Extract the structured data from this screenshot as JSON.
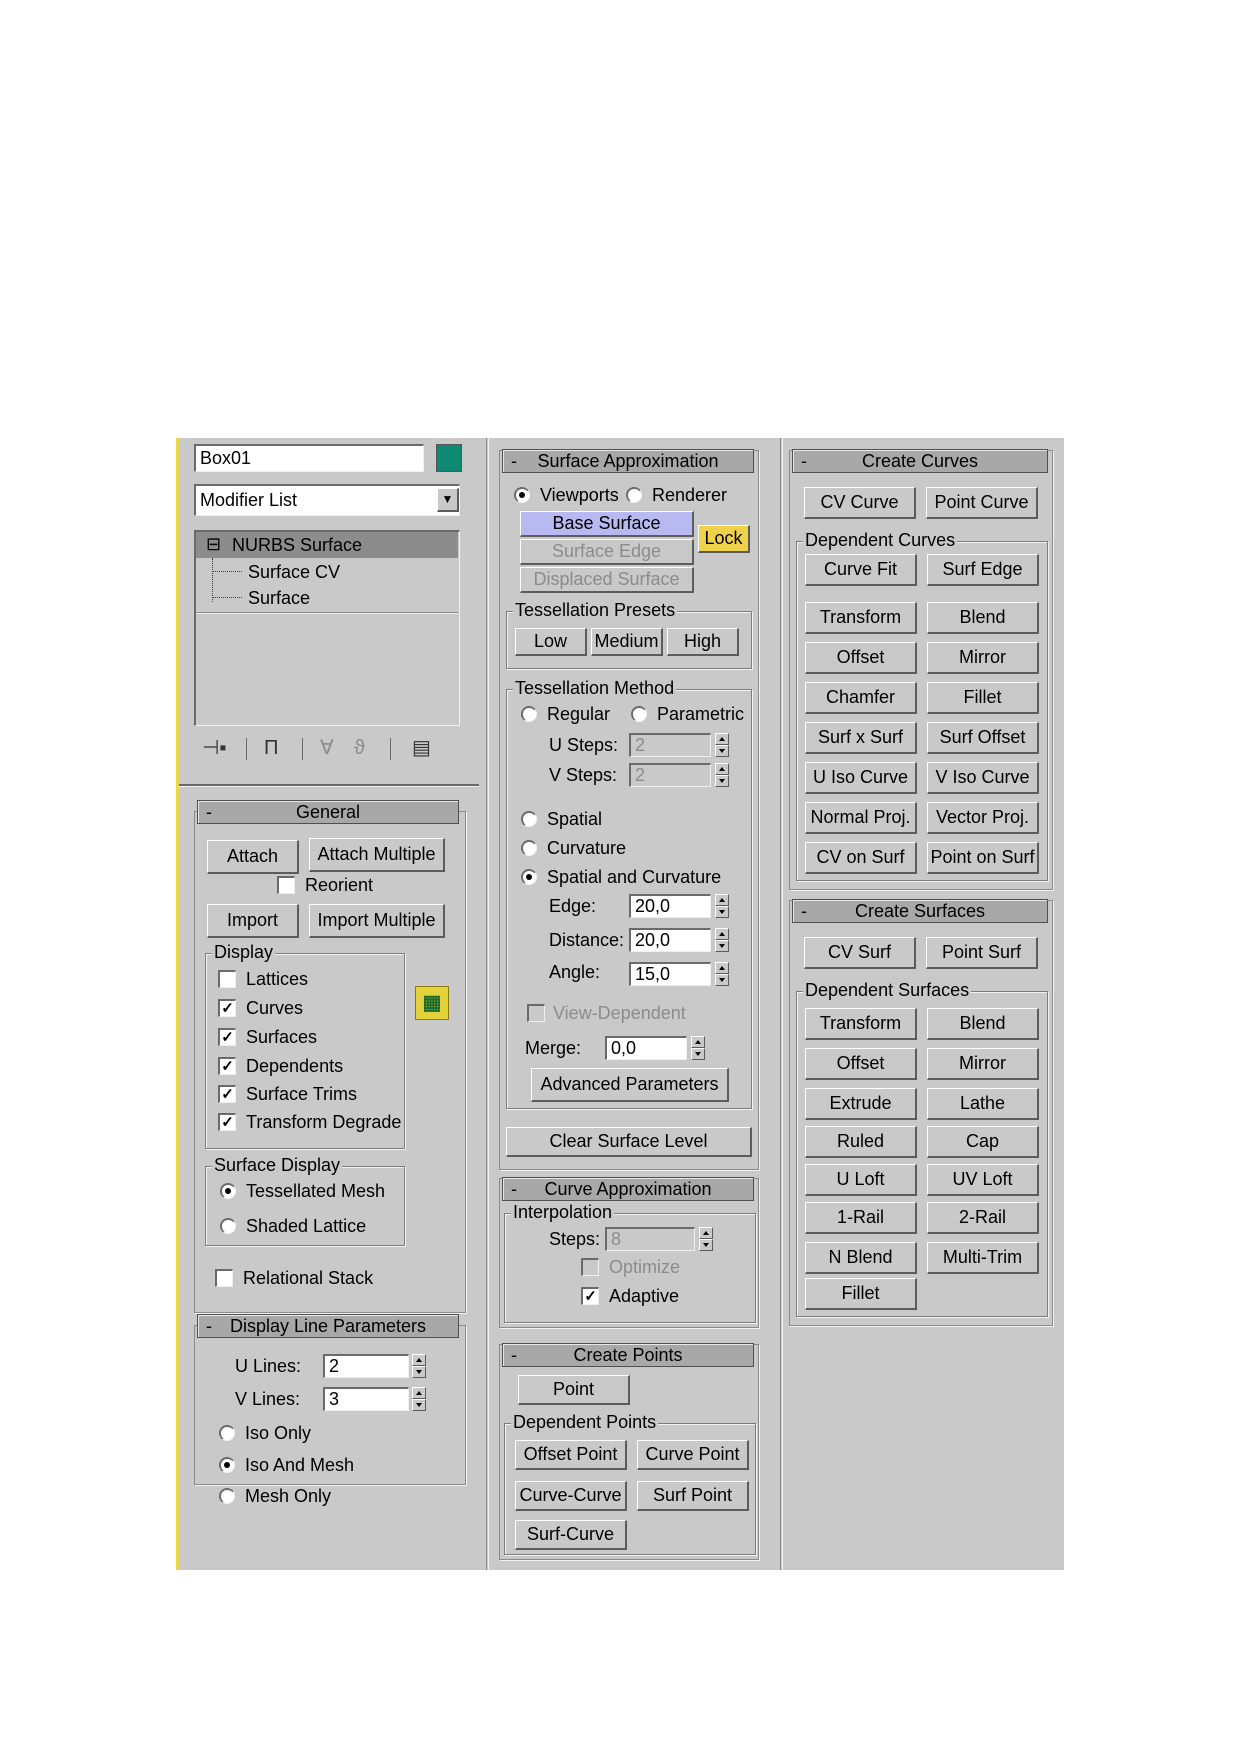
{
  "object_name": "Box01",
  "object_color": "#0e8a72",
  "modifier_list": "Modifier List",
  "stack": {
    "root": "NURBS Surface",
    "children": [
      "Surface CV",
      "Surface"
    ]
  },
  "general": {
    "title": "General",
    "attach": "Attach",
    "attach_multiple": "Attach Multiple",
    "reorient": "Reorient",
    "import": "Import",
    "import_multiple": "Import Multiple",
    "display": {
      "title": "Display",
      "items": [
        "Lattices",
        "Curves",
        "Surfaces",
        "Dependents",
        "Surface Trims",
        "Transform Degrade"
      ],
      "checked": [
        false,
        true,
        true,
        true,
        true,
        true
      ]
    },
    "surface_display": {
      "title": "Surface Display",
      "items": [
        "Tessellated Mesh",
        "Shaded Lattice"
      ],
      "selected": 0
    },
    "relational_stack": "Relational Stack"
  },
  "display_line": {
    "title": "Display Line Parameters",
    "u_label": "U Lines:",
    "u_value": "2",
    "v_label": "V Lines:",
    "v_value": "3",
    "options": [
      "Iso Only",
      "Iso And Mesh",
      "Mesh Only"
    ],
    "selected": 1
  },
  "surface_approx": {
    "title": "Surface Approximation",
    "viewports": "Viewports",
    "renderer": "Renderer",
    "base_surface": "Base Surface",
    "surface_edge": "Surface Edge",
    "displaced_surface": "Displaced Surface",
    "lock": "Lock",
    "presets": {
      "title": "Tessellation Presets",
      "low": "Low",
      "medium": "Medium",
      "high": "High"
    },
    "method": {
      "title": "Tessellation Method",
      "regular": "Regular",
      "parametric": "Parametric",
      "u_steps_label": "U Steps:",
      "u_steps": "2",
      "v_steps_label": "V Steps:",
      "v_steps": "2",
      "spatial": "Spatial",
      "curvature": "Curvature",
      "spatial_curvature": "Spatial and Curvature",
      "edge_label": "Edge:",
      "edge": "20,0",
      "distance_label": "Distance:",
      "distance": "20,0",
      "angle_label": "Angle:",
      "angle": "15,0",
      "view_dependent": "View-Dependent",
      "merge_label": "Merge:",
      "merge": "0,0",
      "advanced": "Advanced Parameters"
    },
    "clear": "Clear Surface Level"
  },
  "curve_approx": {
    "title": "Curve Approximation",
    "interpolation": "Interpolation",
    "steps_label": "Steps:",
    "steps": "8",
    "optimize": "Optimize",
    "adaptive": "Adaptive"
  },
  "create_points": {
    "title": "Create Points",
    "point": "Point",
    "dependent_title": "Dependent Points",
    "dependent": [
      "Offset Point",
      "Curve Point",
      "Curve-Curve",
      "Surf Point",
      "Surf-Curve"
    ]
  },
  "create_curves": {
    "title": "Create Curves",
    "cv_curve": "CV Curve",
    "point_curve": "Point Curve",
    "dependent_title": "Dependent Curves",
    "dependent": [
      "Curve Fit",
      "Surf Edge",
      "Transform",
      "Blend",
      "Offset",
      "Mirror",
      "Chamfer",
      "Fillet",
      "Surf x Surf",
      "Surf Offset",
      "U Iso Curve",
      "V Iso Curve",
      "Normal Proj.",
      "Vector Proj.",
      "CV on Surf",
      "Point on Surf"
    ]
  },
  "create_surfaces": {
    "title": "Create Surfaces",
    "cv_surf": "CV Surf",
    "point_surf": "Point Surf",
    "dependent_title": "Dependent Surfaces",
    "dependent": [
      "Transform",
      "Blend",
      "Offset",
      "Mirror",
      "Extrude",
      "Lathe",
      "Ruled",
      "Cap",
      "U Loft",
      "UV Loft",
      "1-Rail",
      "2-Rail",
      "N Blend",
      "Multi-Trim",
      "Fillet"
    ]
  },
  "colors": {
    "panel": "#c9c9c9",
    "highlight": "#b9b9f2",
    "lock": "#f0d24a",
    "stack_selected": "#8c8c8c"
  }
}
